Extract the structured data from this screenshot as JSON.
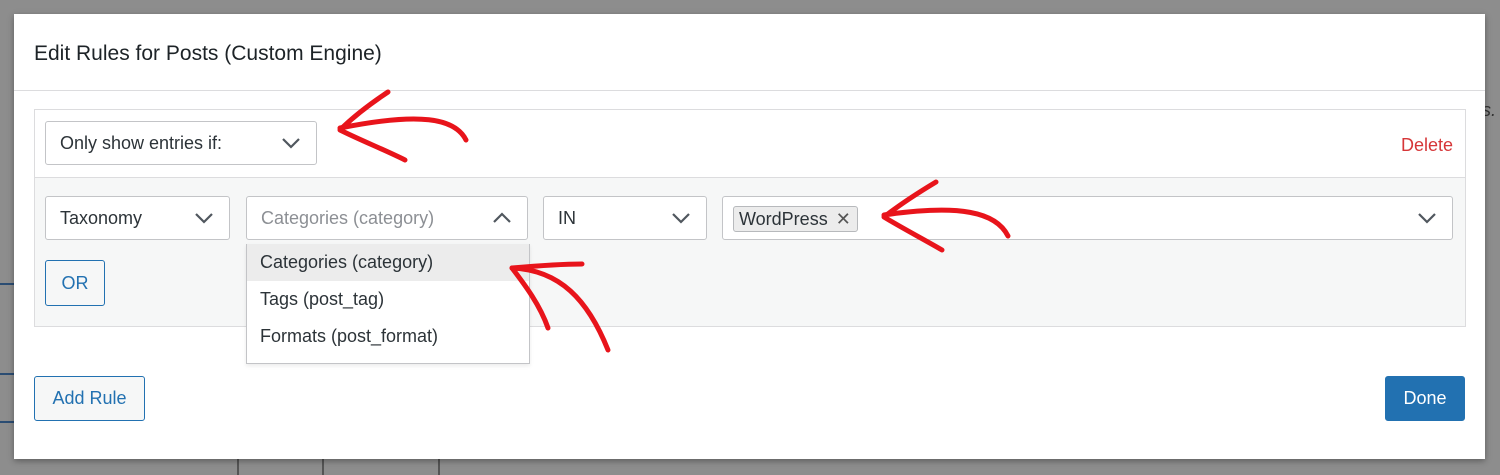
{
  "modal": {
    "title": "Edit Rules for Posts (Custom Engine)"
  },
  "background": {
    "partial_text": "es."
  },
  "rule": {
    "condition_select": "Only show entries if:",
    "delete_label": "Delete",
    "type_select": "Taxonomy",
    "taxonomy_select_placeholder": "Categories (category)",
    "operator_select": "IN",
    "selected_terms": [
      "WordPress"
    ],
    "remove_symbol": "✕",
    "or_label": "OR"
  },
  "taxonomy_dropdown": {
    "options": [
      "Categories (category)",
      "Tags (post_tag)",
      "Formats (post_format)"
    ],
    "highlighted_index": 0
  },
  "footer": {
    "add_rule_label": "Add Rule",
    "done_label": "Done"
  },
  "colors": {
    "accent": "#2271b1",
    "delete": "#d63638",
    "annotation": "#e8141b"
  },
  "icons": {
    "chevron_down": "chevron-down-icon",
    "chevron_up": "chevron-up-icon",
    "remove": "remove-icon"
  }
}
